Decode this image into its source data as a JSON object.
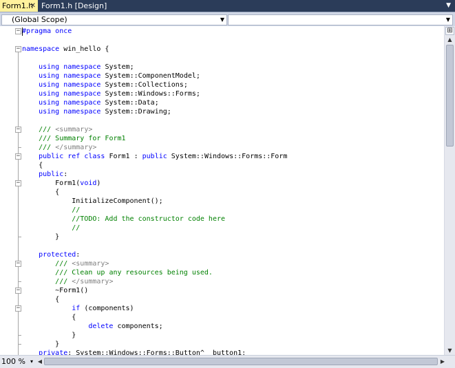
{
  "tabs": [
    {
      "label": "Form1.h",
      "active": true,
      "close_glyph": "✕"
    },
    {
      "label": "Form1.h [Design]",
      "active": false
    }
  ],
  "tab_dropdown_glyph": "▼",
  "scope": {
    "left_value": "(Global Scope)",
    "right_value": ""
  },
  "colors": {
    "keyword": "#0000ff",
    "comment": "#008000",
    "xml_doc_tag": "#808080",
    "active_tab": "#fff29d",
    "tab_strip": "#2b3c59"
  },
  "code_lines": [
    [
      {
        "t": "#pragma",
        "c": "kw"
      },
      {
        "t": " once",
        "c": "kw"
      }
    ],
    [],
    [
      {
        "t": "namespace",
        "c": "kw"
      },
      {
        "t": " win_hello {",
        "c": ""
      }
    ],
    [],
    [
      {
        "t": "    ",
        "c": ""
      },
      {
        "t": "using",
        "c": "kw"
      },
      {
        "t": " ",
        "c": ""
      },
      {
        "t": "namespace",
        "c": "kw"
      },
      {
        "t": " System;",
        "c": ""
      }
    ],
    [
      {
        "t": "    ",
        "c": ""
      },
      {
        "t": "using",
        "c": "kw"
      },
      {
        "t": " ",
        "c": ""
      },
      {
        "t": "namespace",
        "c": "kw"
      },
      {
        "t": " System::ComponentModel;",
        "c": ""
      }
    ],
    [
      {
        "t": "    ",
        "c": ""
      },
      {
        "t": "using",
        "c": "kw"
      },
      {
        "t": " ",
        "c": ""
      },
      {
        "t": "namespace",
        "c": "kw"
      },
      {
        "t": " System::Collections;",
        "c": ""
      }
    ],
    [
      {
        "t": "    ",
        "c": ""
      },
      {
        "t": "using",
        "c": "kw"
      },
      {
        "t": " ",
        "c": ""
      },
      {
        "t": "namespace",
        "c": "kw"
      },
      {
        "t": " System::Windows::Forms;",
        "c": ""
      }
    ],
    [
      {
        "t": "    ",
        "c": ""
      },
      {
        "t": "using",
        "c": "kw"
      },
      {
        "t": " ",
        "c": ""
      },
      {
        "t": "namespace",
        "c": "kw"
      },
      {
        "t": " System::Data;",
        "c": ""
      }
    ],
    [
      {
        "t": "    ",
        "c": ""
      },
      {
        "t": "using",
        "c": "kw"
      },
      {
        "t": " ",
        "c": ""
      },
      {
        "t": "namespace",
        "c": "kw"
      },
      {
        "t": " System::Drawing;",
        "c": ""
      }
    ],
    [],
    [
      {
        "t": "    ",
        "c": ""
      },
      {
        "t": "/// ",
        "c": "cm"
      },
      {
        "t": "<summary>",
        "c": "xml"
      }
    ],
    [
      {
        "t": "    ",
        "c": ""
      },
      {
        "t": "/// Summary for Form1",
        "c": "cm"
      }
    ],
    [
      {
        "t": "    ",
        "c": ""
      },
      {
        "t": "/// ",
        "c": "cm"
      },
      {
        "t": "</summary>",
        "c": "xml"
      }
    ],
    [
      {
        "t": "    ",
        "c": ""
      },
      {
        "t": "public",
        "c": "kw"
      },
      {
        "t": " ",
        "c": ""
      },
      {
        "t": "ref",
        "c": "kw"
      },
      {
        "t": " ",
        "c": ""
      },
      {
        "t": "class",
        "c": "kw"
      },
      {
        "t": " Form1 : ",
        "c": ""
      },
      {
        "t": "public",
        "c": "kw"
      },
      {
        "t": " System::Windows::Forms::Form",
        "c": ""
      }
    ],
    [
      {
        "t": "    {",
        "c": ""
      }
    ],
    [
      {
        "t": "    ",
        "c": ""
      },
      {
        "t": "public",
        "c": "kw"
      },
      {
        "t": ":",
        "c": ""
      }
    ],
    [
      {
        "t": "        Form1(",
        "c": ""
      },
      {
        "t": "void",
        "c": "kw"
      },
      {
        "t": ")",
        "c": ""
      }
    ],
    [
      {
        "t": "        {",
        "c": ""
      }
    ],
    [
      {
        "t": "            InitializeComponent();",
        "c": ""
      }
    ],
    [
      {
        "t": "            //",
        "c": "cm"
      }
    ],
    [
      {
        "t": "            //TODO: Add the constructor code here",
        "c": "cm"
      }
    ],
    [
      {
        "t": "            //",
        "c": "cm"
      }
    ],
    [
      {
        "t": "        }",
        "c": ""
      }
    ],
    [],
    [
      {
        "t": "    ",
        "c": ""
      },
      {
        "t": "protected",
        "c": "kw"
      },
      {
        "t": ":",
        "c": ""
      }
    ],
    [
      {
        "t": "        ",
        "c": ""
      },
      {
        "t": "/// ",
        "c": "cm"
      },
      {
        "t": "<summary>",
        "c": "xml"
      }
    ],
    [
      {
        "t": "        ",
        "c": ""
      },
      {
        "t": "/// Clean up any resources being used.",
        "c": "cm"
      }
    ],
    [
      {
        "t": "        ",
        "c": ""
      },
      {
        "t": "/// ",
        "c": "cm"
      },
      {
        "t": "</summary>",
        "c": "xml"
      }
    ],
    [
      {
        "t": "        ~Form1()",
        "c": ""
      }
    ],
    [
      {
        "t": "        {",
        "c": ""
      }
    ],
    [
      {
        "t": "            ",
        "c": ""
      },
      {
        "t": "if",
        "c": "kw"
      },
      {
        "t": " (components)",
        "c": ""
      }
    ],
    [
      {
        "t": "            {",
        "c": ""
      }
    ],
    [
      {
        "t": "                ",
        "c": ""
      },
      {
        "t": "delete",
        "c": "kw"
      },
      {
        "t": " components;",
        "c": ""
      }
    ],
    [
      {
        "t": "            }",
        "c": ""
      }
    ],
    [
      {
        "t": "        }",
        "c": ""
      }
    ],
    [
      {
        "t": "    ",
        "c": ""
      },
      {
        "t": "private",
        "c": "kw"
      },
      {
        "t": ": System::Windows::Forms::Button^  button1;",
        "c": ""
      }
    ]
  ],
  "folds": [
    0,
    2,
    11,
    14,
    17,
    26,
    29,
    31
  ],
  "zoom": {
    "value": "100 %",
    "arrow": "▾"
  },
  "scroll_glyphs": {
    "up": "▲",
    "down": "▼",
    "left": "◀",
    "right": "▶",
    "split": "⊞"
  }
}
